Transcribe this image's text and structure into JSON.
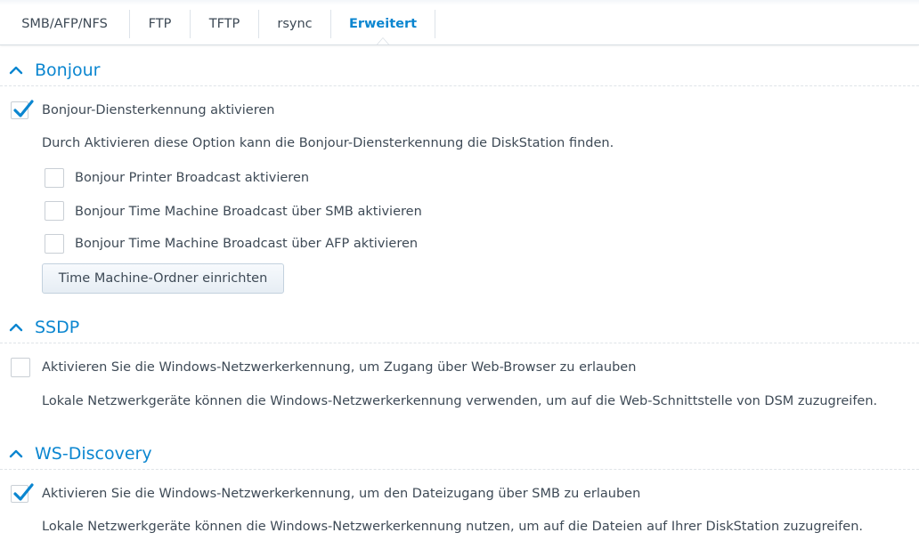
{
  "tabs": [
    {
      "label": "SMB/AFP/NFS",
      "active": false
    },
    {
      "label": "FTP",
      "active": false
    },
    {
      "label": "TFTP",
      "active": false
    },
    {
      "label": "rsync",
      "active": false
    },
    {
      "label": "Erweitert",
      "active": true
    }
  ],
  "colors": {
    "accent": "#0b86d0",
    "text": "#3e4a56",
    "check": "#0b86d0"
  },
  "bonjour": {
    "title": "Bonjour",
    "enable_label": "Bonjour-Diensterkennung aktivieren",
    "enable_checked": true,
    "description": "Durch Aktivieren diese Option kann die Bonjour-Diensterkennung die DiskStation finden.",
    "options": [
      {
        "label": "Bonjour Printer Broadcast aktivieren",
        "checked": false
      },
      {
        "label": "Bonjour Time Machine Broadcast über SMB aktivieren",
        "checked": false
      },
      {
        "label": "Bonjour Time Machine Broadcast über AFP aktivieren",
        "checked": false
      }
    ],
    "button_label": "Time Machine-Ordner einrichten"
  },
  "ssdp": {
    "title": "SSDP",
    "enable_label": "Aktivieren Sie die Windows-Netzwerkerkennung, um Zugang über Web-Browser zu erlauben",
    "enable_checked": false,
    "description": "Lokale Netzwerkgeräte können die Windows-Netzwerkerkennung verwenden, um auf die Web-Schnittstelle von DSM zuzugreifen."
  },
  "ws_discovery": {
    "title": "WS-Discovery",
    "enable_label": "Aktivieren Sie die Windows-Netzwerkerkennung, um den Dateizugang über SMB zu erlauben",
    "enable_checked": true,
    "description": "Lokale Netzwerkgeräte können die Windows-Netzwerkerkennung nutzen, um auf die Dateien auf Ihrer DiskStation zuzugreifen."
  }
}
